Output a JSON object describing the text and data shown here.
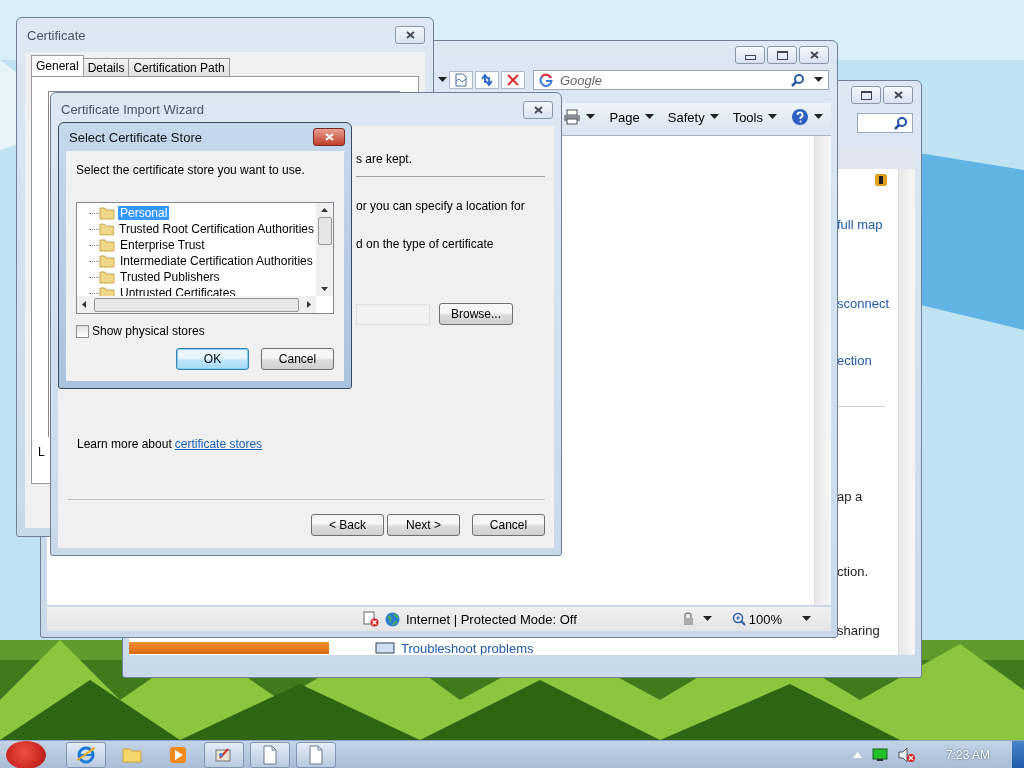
{
  "browser_back": {
    "content": [
      {
        "kind": "link",
        "text": "full map"
      },
      {
        "kind": "link",
        "text": "sconnect"
      },
      {
        "kind": "link",
        "text": "ection"
      },
      {
        "kind": "text",
        "text": "ap a"
      },
      {
        "kind": "text",
        "text": "ction."
      },
      {
        "kind": "text",
        "text": "sharing"
      }
    ],
    "footer_link": "Troubleshoot problems"
  },
  "browser": {
    "search": {
      "placeholder": "Google"
    },
    "command_bar": [
      {
        "label": "Page"
      },
      {
        "label": "Safety"
      },
      {
        "label": "Tools"
      }
    ],
    "status": "Internet | Protected Mode: Off",
    "zoom": "100%"
  },
  "certificate": {
    "title": "Certificate",
    "tabs": [
      {
        "label": "General",
        "selected": true
      },
      {
        "label": "Details",
        "selected": false
      },
      {
        "label": "Certification Path",
        "selected": false
      }
    ],
    "fragment": "L"
  },
  "wizard": {
    "title": "Certificate Import Wizard",
    "fragments": [
      "s are kept.",
      "or you can specify a location for",
      "d on the type of certificate"
    ],
    "browse": "Browse...",
    "learn_more": {
      "text": "Learn more about",
      "link": "certificate stores"
    },
    "buttons": [
      "< Back",
      "Next >",
      "Cancel"
    ]
  },
  "store_dialog": {
    "title": "Select Certificate Store",
    "prompt": "Select the certificate store you want to use.",
    "stores": [
      {
        "label": "Personal",
        "selected": true
      },
      {
        "label": "Trusted Root Certification Authorities",
        "selected": false
      },
      {
        "label": "Enterprise Trust",
        "selected": false
      },
      {
        "label": "Intermediate Certification Authorities",
        "selected": false
      },
      {
        "label": "Trusted Publishers",
        "selected": false
      },
      {
        "label": "Untrusted Certificates",
        "selected": false
      }
    ],
    "show_physical": {
      "label": "Show physical stores",
      "checked": false
    },
    "buttons": [
      "OK",
      "Cancel"
    ]
  },
  "taskbar": {
    "items": [
      {
        "kind": "browser",
        "running": true
      },
      {
        "kind": "folder",
        "running": false
      },
      {
        "kind": "media",
        "running": false
      },
      {
        "kind": "app",
        "running": true
      },
      {
        "kind": "document",
        "running": true
      },
      {
        "kind": "document",
        "running": true
      }
    ],
    "clock": "7:23 AM"
  }
}
